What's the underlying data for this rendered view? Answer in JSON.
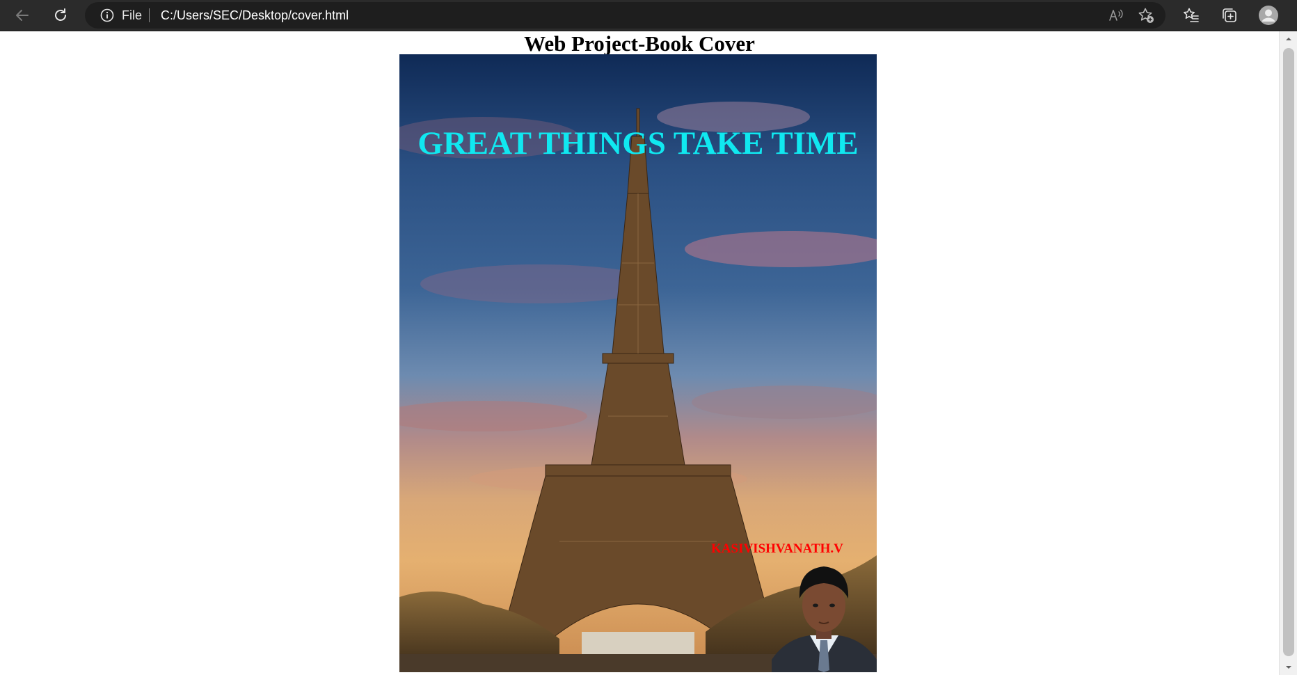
{
  "browser": {
    "address_scheme_label": "File",
    "address_url": "C:/Users/SEC/Desktop/cover.html",
    "icons": {
      "back": "arrow-left-icon",
      "reload": "reload-icon",
      "site_info": "info-icon",
      "read_aloud": "read-aloud-icon",
      "add_favorite": "star-plus-icon",
      "favorites": "favorites-list-icon",
      "collections": "collections-icon",
      "profile": "profile-avatar-icon"
    }
  },
  "page": {
    "heading": "Web Project-Book Cover"
  },
  "cover": {
    "title": "GREAT THINGS TAKE TIME",
    "author": "KASIVISHVANATH.V",
    "colors": {
      "title": "#10e8f0",
      "author": "#ff0000"
    }
  }
}
